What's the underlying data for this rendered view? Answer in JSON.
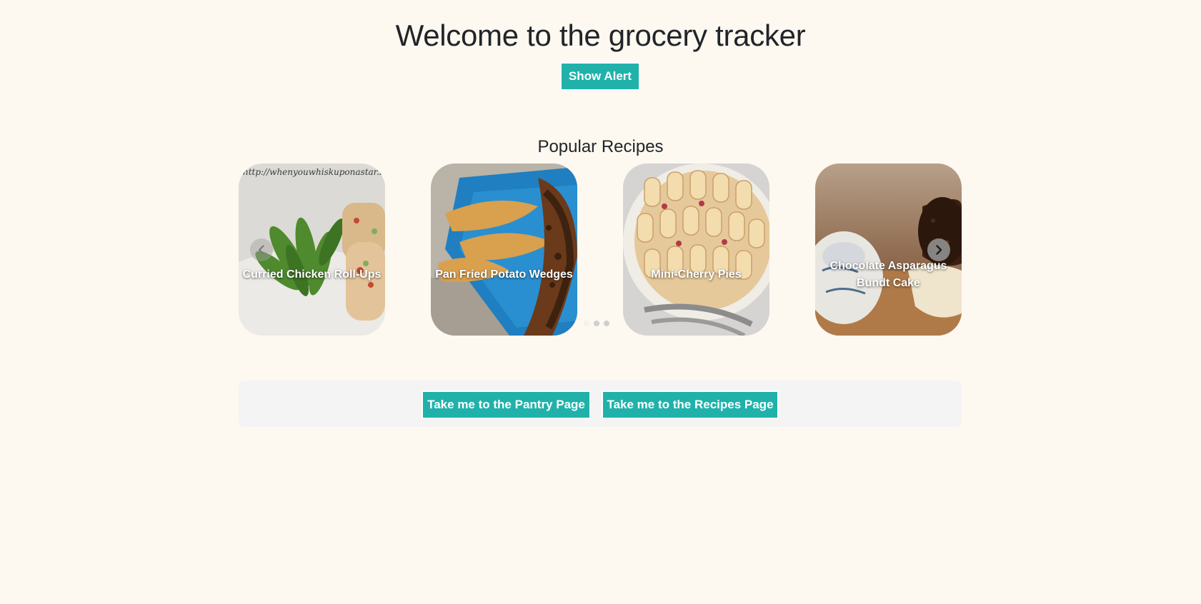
{
  "header": {
    "title": "Welcome to the grocery tracker",
    "alert_button_label": "Show Alert"
  },
  "popular": {
    "heading": "Popular Recipes",
    "recipes": [
      {
        "name": "Curried Chicken Roll-Ups",
        "watermark": "http://whenyouwhiskuponastar.blogs"
      },
      {
        "name": "Pan Fried Potato Wedges"
      },
      {
        "name": "Mini-Cherry Pies"
      },
      {
        "name": "Chocolate Asparagus Bundt Cake"
      }
    ],
    "indicators": {
      "count": 3,
      "active_index": 0
    }
  },
  "footer": {
    "pantry_button_label": "Take me to the Pantry Page",
    "recipes_button_label": "Take me to the Recipes Page"
  },
  "colors": {
    "background": "#fdf8f0",
    "accent": "#20b2aa",
    "panel": "#f4f4f4",
    "text": "#212529"
  },
  "icons": {
    "prev": "chevron-left-icon",
    "next": "chevron-right-icon"
  }
}
